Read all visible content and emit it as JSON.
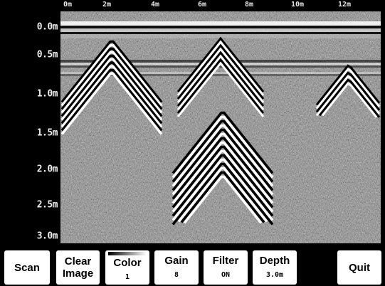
{
  "distance_axis": {
    "labels": [
      "0m",
      "2m",
      "4m",
      "6m",
      "8m",
      "10m",
      "12m"
    ]
  },
  "depth_axis": {
    "labels": [
      "0.0m",
      "0.5m",
      "1.0m",
      "1.5m",
      "2.0m",
      "2.5m",
      "3.0m"
    ]
  },
  "toolbar": {
    "scan": "Scan",
    "clear_line1": "Clear",
    "clear_line2": "Image",
    "color_label": "Color",
    "color_value": "1",
    "gain_label": "Gain",
    "gain_value": "8",
    "filter_label": "Filter",
    "filter_value": "ON",
    "depth_label": "Depth",
    "depth_value": "3.0m",
    "quit": "Quit"
  },
  "colors": {
    "background": "#000000",
    "button": "#ffffff",
    "label_text": "#e6e6e6"
  }
}
